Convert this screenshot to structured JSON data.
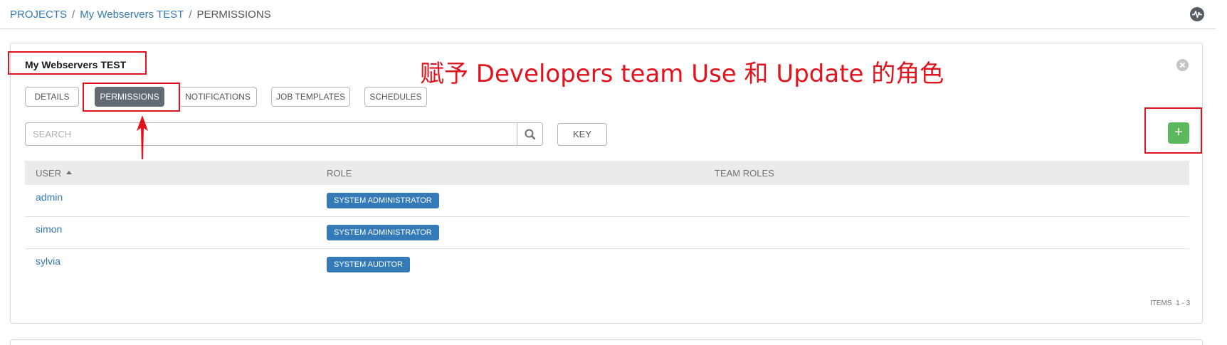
{
  "breadcrumb": {
    "items": [
      "PROJECTS",
      "My Webservers TEST"
    ],
    "current": "PERMISSIONS",
    "separator": "/"
  },
  "card": {
    "title": "My Webservers TEST"
  },
  "tabs": [
    {
      "label": "DETAILS",
      "active": false
    },
    {
      "label": "PERMISSIONS",
      "active": true
    },
    {
      "label": "NOTIFICATIONS",
      "active": false
    },
    {
      "label": "JOB TEMPLATES",
      "active": false
    },
    {
      "label": "SCHEDULES",
      "active": false
    }
  ],
  "search": {
    "placeholder": "SEARCH",
    "value": "",
    "key_label": "KEY"
  },
  "add_button": {
    "label": "+"
  },
  "table": {
    "columns": [
      "USER",
      "ROLE",
      "TEAM ROLES"
    ],
    "sorted_column": "USER",
    "rows": [
      {
        "user": "admin",
        "role": "SYSTEM ADMINISTRATOR",
        "team_roles": ""
      },
      {
        "user": "simon",
        "role": "SYSTEM ADMINISTRATOR",
        "team_roles": ""
      },
      {
        "user": "sylvia",
        "role": "SYSTEM AUDITOR",
        "team_roles": ""
      }
    ]
  },
  "pagination": {
    "items_label": "ITEMS",
    "range": "1 - 3"
  },
  "annotation": {
    "text": "赋予 Developers team Use 和 Update 的角色",
    "color": "#e0141e"
  },
  "colors": {
    "link": "#337ab7",
    "active_tab": "#626b72",
    "add_button": "#5cb85c",
    "role_badge": "#337ab7"
  },
  "icons": [
    "activity-stream-icon",
    "close-icon",
    "search-icon",
    "sort-ascending-icon"
  ]
}
